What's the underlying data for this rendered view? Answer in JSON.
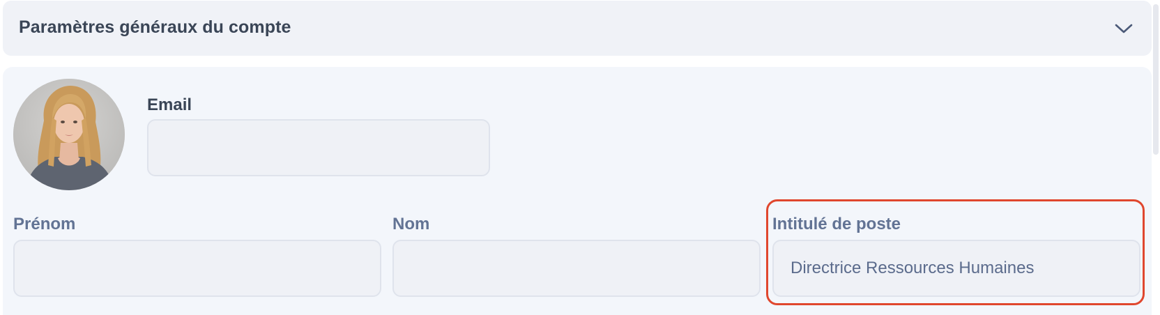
{
  "section": {
    "title": "Paramètres généraux du compte",
    "toggle_icon": "chevron-down-icon"
  },
  "profile": {
    "avatar_icon": "user-avatar-photo"
  },
  "fields": {
    "email": {
      "label": "Email",
      "value": ""
    },
    "prenom": {
      "label": "Prénom",
      "value": ""
    },
    "nom": {
      "label": "Nom",
      "value": ""
    },
    "job_title": {
      "label": "Intitulé de poste",
      "value": "Directrice Ressources Humaines"
    }
  },
  "colors": {
    "accent_highlight": "#e0472e",
    "label_color": "#627394",
    "title_color": "#3a4556"
  }
}
